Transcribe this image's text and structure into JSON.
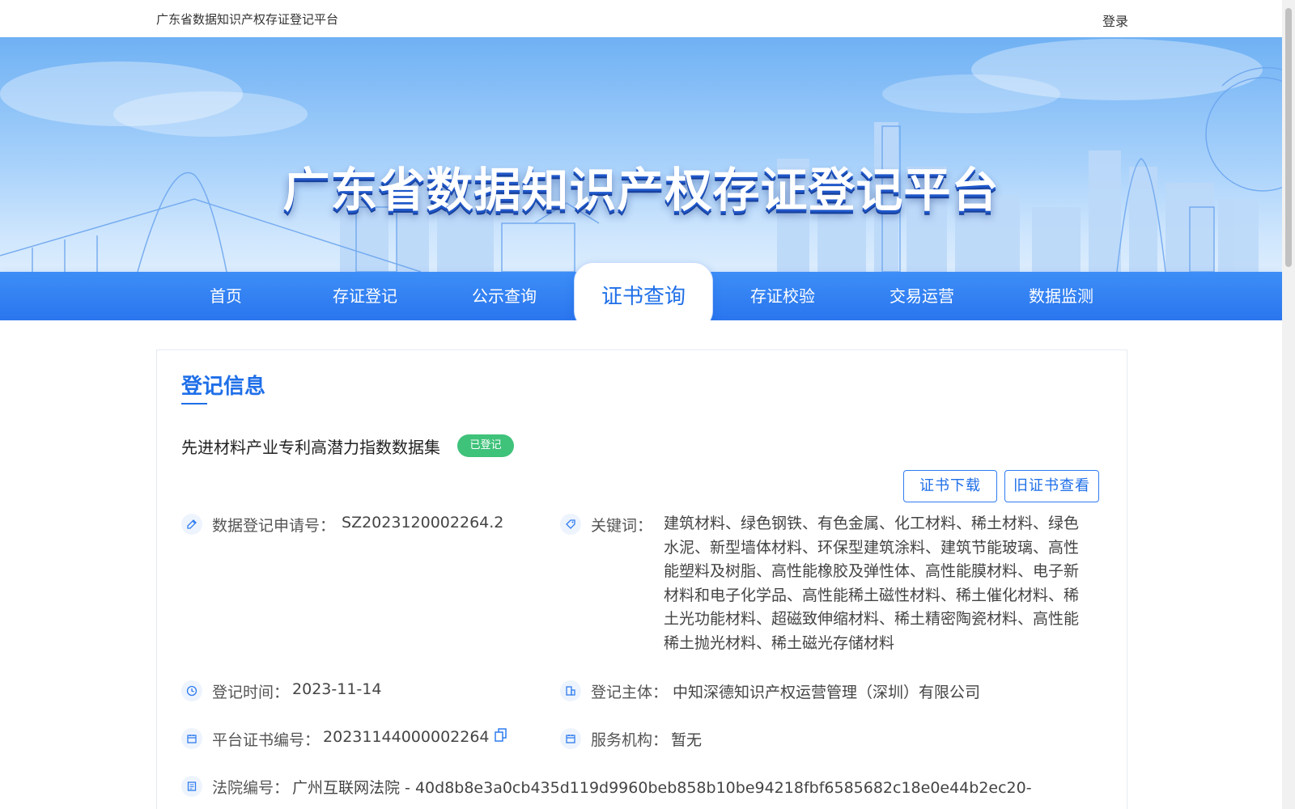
{
  "topbar": {
    "site_name": "广东省数据知识产权存证登记平台",
    "login": "登录"
  },
  "banner": {
    "title": "广东省数据知识产权存证登记平台"
  },
  "nav": {
    "items": [
      "首页",
      "存证登记",
      "公示查询",
      "证书查询",
      "存证校验",
      "交易运营",
      "数据监测"
    ],
    "active": "证书查询"
  },
  "card": {
    "title": "登记信息",
    "dataset_name": "先进材料产业专利高潜力指数数据集",
    "status": "已登记",
    "download_btn": "证书下载",
    "old_cert_btn": "旧证书查看"
  },
  "fields": {
    "app_no_label": "数据登记申请号：",
    "app_no": "SZ2023120002264.2",
    "keywords_label": "关键词：",
    "keywords": "建筑材料、绿色钢铁、有色金属、化工材料、稀土材料、绿色水泥、新型墙体材料、环保型建筑涂料、建筑节能玻璃、高性能塑料及树脂、高性能橡胶及弹性体、高性能膜材料、电子新材料和电子化学品、高性能稀土磁性材料、稀土催化材料、稀土光功能材料、超磁致伸缩材料、稀土精密陶瓷材料、高性能稀土抛光材料、稀土磁光存储材料",
    "reg_time_label": "登记时间：",
    "reg_time": "2023-11-14",
    "subject_label": "登记主体：",
    "subject": "中知深德知识产权运营管理（深圳）有限公司",
    "cert_no_label": "平台证书编号：",
    "cert_no": "20231144000002264",
    "agency_label": "服务机构：",
    "agency": "暂无",
    "court_label": "法院编号：",
    "court": "广州互联网法院 - 40d8b8e3a0cb435d119d9960beb858b10be94218fbf6585682c18e0e44b2ec20-"
  },
  "colors": {
    "primary": "#1f6fe8",
    "badge": "#3fc27a",
    "nav": "#2a75ee"
  }
}
